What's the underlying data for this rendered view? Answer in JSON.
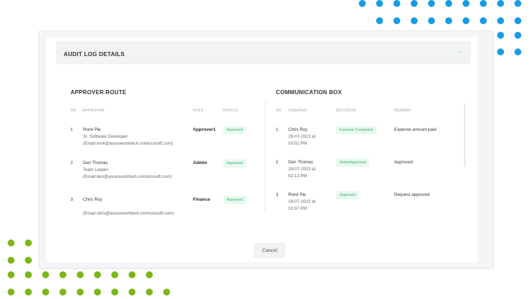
{
  "accordion": {
    "title": "AUDIT LOG DETAILS",
    "expanded_icon": "chevron-up-icon"
  },
  "approver_route": {
    "title": "APPROVER ROUTE",
    "headers": {
      "sr": "SR",
      "approver": "APPROVER",
      "role": "ROLE",
      "status": "STATUS"
    },
    "rows": [
      {
        "sr": "1",
        "name": "Ronit Pie",
        "designation": "Sr. Software Developer",
        "email": "(Email:ronit@ascenworktech.onmicrosoft.com)",
        "role": "Approver1",
        "status": "Approved"
      },
      {
        "sr": "2",
        "name": "Den Thomas",
        "designation": "Team Leader",
        "email": "(Email:den@ascenworktech.onmicrosoft.com)",
        "role": "Admin",
        "status": "Approved"
      },
      {
        "sr": "3",
        "name": "Chris Roy",
        "designation": "",
        "email": "(Email:chris@ascenworktech.onmicrosoft.com)",
        "role": "Finance",
        "status": "Approved"
      }
    ]
  },
  "communication_box": {
    "title": "COMMUNICATION BOX",
    "headers": {
      "sr": "SR",
      "created": "CREATED",
      "decision": "DECISION",
      "remark": "REMARK"
    },
    "rows": [
      {
        "sr": "1",
        "name": "Chris Roy",
        "date": "29-07-2023 at",
        "time": "03:02 PM",
        "decision": "Expense Completed",
        "remark": "Expense amount paid"
      },
      {
        "sr": "2",
        "name": "Den Thomas",
        "date": "29-07-2023 at",
        "time": "02:13 PM",
        "decision": "AdminApproved",
        "remark": "Approved"
      },
      {
        "sr": "3",
        "name": "Ronit Pie",
        "date": "29-07-2023 at",
        "time": "02:07 PM",
        "decision": "Approved",
        "remark": "Request approved"
      }
    ]
  },
  "footer": {
    "cancel_label": "Cancel"
  },
  "colors": {
    "blue_dots": "#169be6",
    "green_dots": "#7cb518",
    "status_green": "#3cb371",
    "badge_bg": "#e9f8ef"
  }
}
